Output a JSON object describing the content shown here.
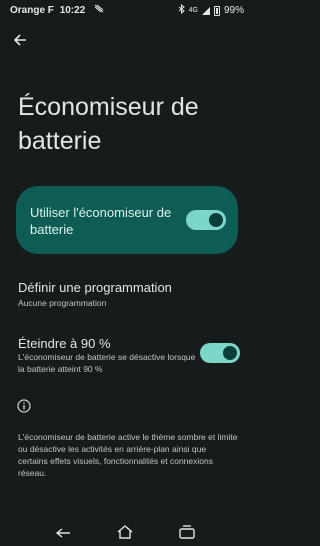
{
  "status_bar": {
    "carrier": "Orange F",
    "time": "10:22",
    "network": "4G",
    "battery": "99%"
  },
  "icons": {
    "back": "arrow-left-icon",
    "info": "info-icon",
    "cast": "cast-icon",
    "bluetooth": "bluetooth-icon",
    "signal": "signal-icon",
    "battery": "battery-icon"
  },
  "colors": {
    "background": "#151c1b",
    "card": "#0f5c55",
    "switch_track": "#7dd7c9",
    "switch_knob": "#0c3f3a"
  },
  "page": {
    "title": "Économiseur de batterie"
  },
  "main_toggle": {
    "label": "Utiliser l'économiseur de batterie",
    "on": true
  },
  "schedule": {
    "title": "Définir une programmation",
    "subtitle": "Aucune programmation"
  },
  "turn_off": {
    "title": "Éteindre à 90 %",
    "subtitle": "L'économiseur de batterie se désactive lorsque la batterie atteint 90 %",
    "on": true
  },
  "footer": {
    "text": "L'économiseur de batterie active le thème sombre et limite ou désactive les activités en arrière-plan ainsi que certains effets visuels, fonctionnalités et connexions réseau."
  }
}
